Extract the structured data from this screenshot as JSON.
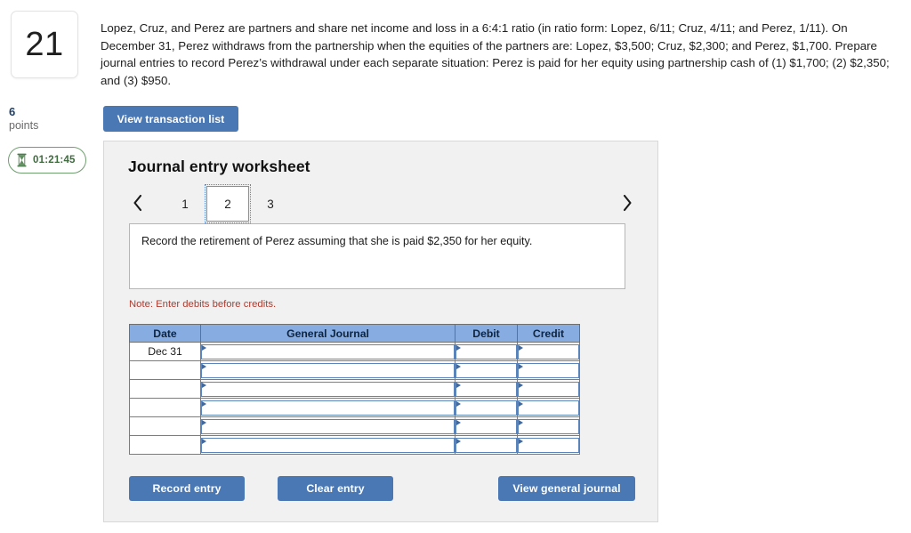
{
  "question": {
    "number": "21",
    "points_value": "6",
    "points_label": "points",
    "timer": "01:21:45",
    "timer_icon": "hourglass-icon",
    "body": "Lopez, Cruz, and Perez are partners and share net income and loss in a 6:4:1 ratio (in ratio form: Lopez, 6/11; Cruz, 4/11; and Perez, 1/11). On December 31, Perez withdraws from the partnership when the equities of the partners are: Lopez, $3,500; Cruz, $2,300; and Perez, $1,700. Prepare journal entries to record Perez’s withdrawal under each separate situation: Perez is paid for her equity using partnership cash of (1) $1,700; (2) $2,350; and (3) $950."
  },
  "toolbar": {
    "view_transaction_list_label": "View transaction list"
  },
  "worksheet": {
    "title": "Journal entry worksheet",
    "pager": {
      "prev_icon": "chevron-left-icon",
      "next_icon": "chevron-right-icon",
      "tabs": [
        "1",
        "2",
        "3"
      ],
      "active_tab": "2"
    },
    "instruction": "Record the retirement of Perez assuming that she is paid $2,350 for her equity.",
    "note": "Note: Enter debits before credits.",
    "table": {
      "columns": [
        "Date",
        "General Journal",
        "Debit",
        "Credit"
      ],
      "rows": [
        {
          "date": "Dec 31",
          "general_journal": "",
          "debit": "",
          "credit": ""
        },
        {
          "date": "",
          "general_journal": "",
          "debit": "",
          "credit": ""
        },
        {
          "date": "",
          "general_journal": "",
          "debit": "",
          "credit": ""
        },
        {
          "date": "",
          "general_journal": "",
          "debit": "",
          "credit": ""
        },
        {
          "date": "",
          "general_journal": "",
          "debit": "",
          "credit": ""
        },
        {
          "date": "",
          "general_journal": "",
          "debit": "",
          "credit": ""
        }
      ]
    },
    "buttons": {
      "record_entry": "Record entry",
      "clear_entry": "Clear entry",
      "view_general_journal": "View general journal"
    }
  },
  "colors": {
    "button_blue": "#4a78b5",
    "table_header_blue": "#86ace1",
    "input_border_blue": "#5c85bb",
    "note_red": "#b03a2e",
    "timer_green": "#3f6b3f",
    "points_navy": "#1d3f69",
    "panel_gray": "#f1f1f1"
  }
}
